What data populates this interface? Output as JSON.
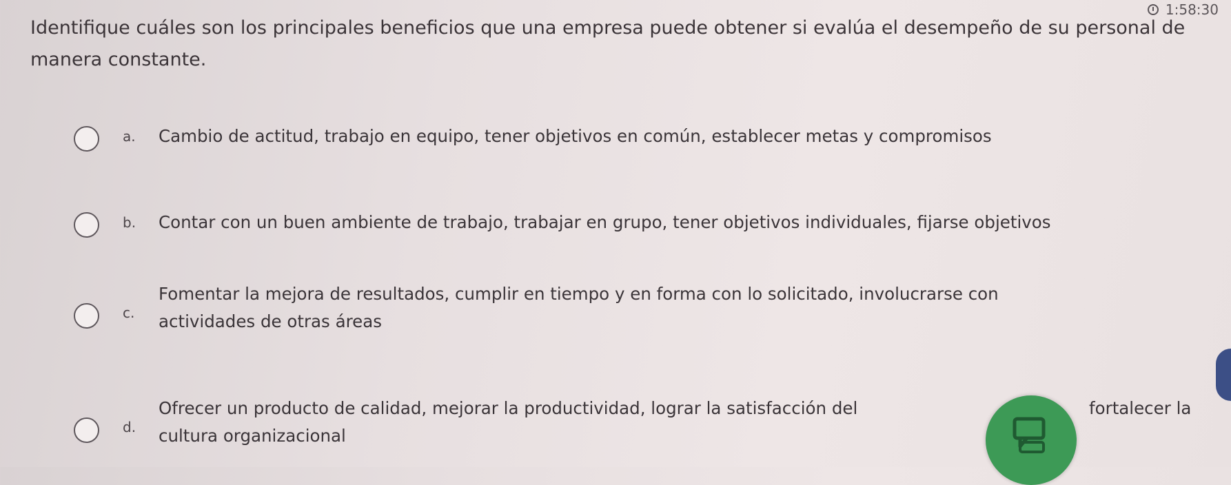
{
  "timer": {
    "icon": "clock-icon",
    "value": "1:58:30"
  },
  "question": {
    "text": "Identifique cuáles son los principales beneficios que una empresa puede obtener si evalúa el desempeño de su personal de manera constante."
  },
  "options": [
    {
      "letter": "a.",
      "text": "Cambio de actitud, trabajo en equipo, tener objetivos en común, establecer metas y compromisos",
      "selected": false
    },
    {
      "letter": "b.",
      "text": "Contar con un buen ambiente de trabajo, trabajar en grupo, tener objetivos individuales, fijarse objetivos",
      "selected": false
    },
    {
      "letter": "c.",
      "line1": "Fomentar la mejora de resultados, cumplir en tiempo y en forma con lo solicitado, involucrarse con",
      "line2": "actividades de otras áreas",
      "selected": false
    },
    {
      "letter": "d.",
      "line1_start": "Ofrecer un producto de calidad, mejorar la productividad, lograr la satisfacción del",
      "line1_end": "fortalecer la",
      "line2": "cultura organizacional",
      "selected": false
    }
  ],
  "chat_button": {
    "icon": "chat-icon",
    "color": "#3d9a56"
  },
  "side_tab": {
    "color": "#3c4f86"
  }
}
